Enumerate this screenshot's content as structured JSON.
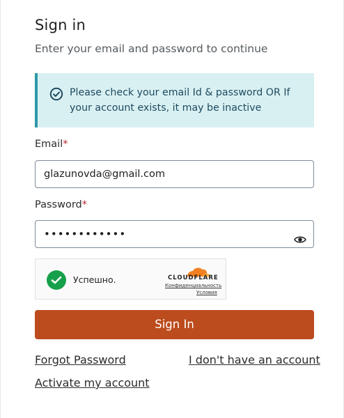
{
  "header": {
    "title": "Sign in",
    "subtitle": "Enter your email and password to continue"
  },
  "alert": {
    "icon": "check-circle-icon",
    "message": "Please check your email Id & password OR If your account exists, it may be inactive",
    "accent_color": "#2b98a8",
    "background_color": "#d9f0f2"
  },
  "form": {
    "email_label": "Email",
    "email_required_mark": "*",
    "email_value": "glazunovda@gmail.com",
    "password_label": "Password",
    "password_required_mark": "*",
    "password_masked": "••••••••••••",
    "password_toggle_icon": "eye-icon"
  },
  "captcha": {
    "status_text": "Успешно.",
    "brand": "CLOUDFLARE",
    "privacy_link": "Конфиденциальность",
    "terms_link": "Условия",
    "success_color": "#17a04a"
  },
  "actions": {
    "sign_in_label": "Sign In",
    "sign_in_color": "#bc4c1d",
    "forgot_password": "Forgot Password",
    "no_account": "I don't have an account",
    "activate_account": "Activate my account"
  }
}
